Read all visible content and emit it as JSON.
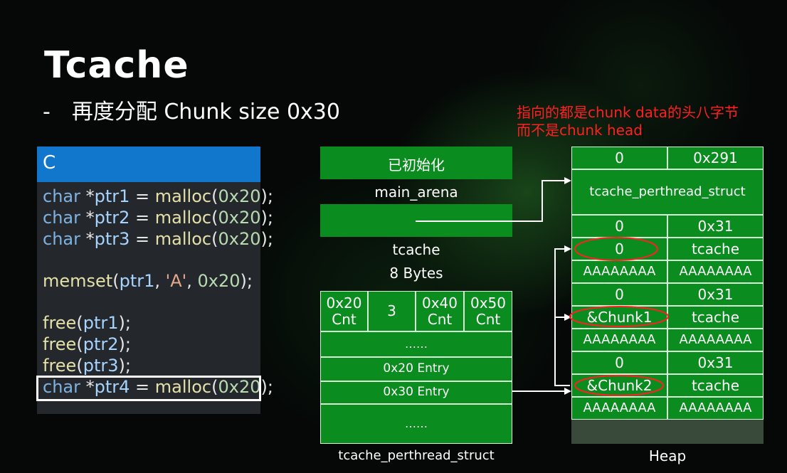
{
  "slide": {
    "title": "Tcache",
    "subtitle_dash": "-",
    "subtitle": "再度分配 Chunk size 0x30",
    "note_line1": "指向的都是chunk data的头八字节",
    "note_line2": "而不是chunk head"
  },
  "code": {
    "header": "C",
    "lines": [
      {
        "kw": "char",
        "op": " *",
        "var": "ptr1",
        "eq": " = ",
        "fn": "malloc",
        "open": "(",
        "num": "0x20",
        "close": ");"
      },
      {
        "kw": "char",
        "op": " *",
        "var": "ptr2",
        "eq": " = ",
        "fn": "malloc",
        "open": "(",
        "num": "0x20",
        "close": ");"
      },
      {
        "kw": "char",
        "op": " *",
        "var": "ptr3",
        "eq": " = ",
        "fn": "malloc",
        "open": "(",
        "num": "0x20",
        "close": ");"
      },
      {
        "kw": "char",
        "op": " *",
        "var": "ptr4",
        "eq": " = ",
        "fn": "malloc",
        "open": "(",
        "num": "0x20",
        "close": ");"
      }
    ],
    "memset": {
      "fn": "memset",
      "open": "(",
      "var": "ptr1",
      "c1": ", ",
      "str": "'A'",
      "c2": ", ",
      "num": "0x20",
      "close": ");"
    },
    "free": [
      {
        "fn": "free",
        "open": "(",
        "var": "ptr1",
        "close": ");"
      },
      {
        "fn": "free",
        "open": "(",
        "var": "ptr2",
        "close": ");"
      },
      {
        "fn": "free",
        "open": "(",
        "var": "ptr3",
        "close": ");"
      }
    ]
  },
  "arena": {
    "initialized": "已初始化",
    "main_arena": "main_arena",
    "tcache": "tcache",
    "bytes": "8 Bytes"
  },
  "tps": {
    "cnt_0x20": "0x20\nCnt",
    "cnt_value": "3",
    "cnt_0x40": "0x40\nCnt",
    "cnt_0x50": "0x50\nCnt",
    "dots1": "……",
    "entry_0x20": "0x20 Entry",
    "entry_0x30": "0x30 Entry",
    "dots2": "……",
    "caption": "tcache_perthread_struct"
  },
  "heap": {
    "top_prev": "0",
    "top_size": "0x291",
    "tps_label": "tcache_perthread_struct",
    "chunks": [
      {
        "prev": "0",
        "size": "0x31",
        "fd": "0",
        "key": "tcache",
        "d1": "AAAAAAAA",
        "d2": "AAAAAAAA"
      },
      {
        "prev": "0",
        "size": "0x31",
        "fd": "&Chunk1",
        "key": "tcache",
        "d1": "AAAAAAAA",
        "d2": "AAAAAAAA"
      },
      {
        "prev": "0",
        "size": "0x31",
        "fd": "&Chunk2",
        "key": "tcache",
        "d1": "AAAAAAAA",
        "d2": "AAAAAAAA"
      }
    ],
    "caption": "Heap"
  },
  "colors": {
    "green": "#0a8c1e",
    "code_header": "#1177cc",
    "annotation": "#ff2020"
  }
}
